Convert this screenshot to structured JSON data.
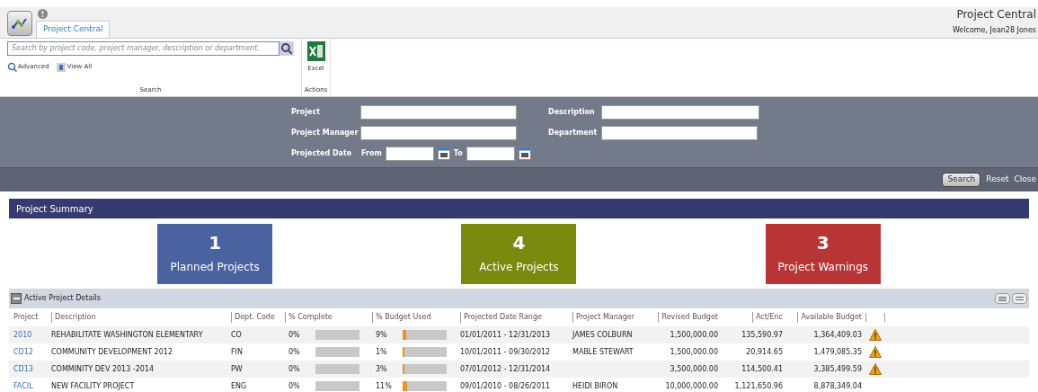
{
  "app": {
    "tab": {
      "label": "Project Central",
      "selected": true
    },
    "title": "Project Central",
    "welcome": "Welcome, Jean28 Jones"
  },
  "ribbon": {
    "search_placeholder": "Search by project code, project manager, description or department.",
    "advanced": "Advanced",
    "view_all": "View All",
    "search_group": "Search",
    "excel": "Excel",
    "actions_group": "Actions"
  },
  "filters": {
    "project": "Project",
    "description": "Description",
    "manager": "Project Manager",
    "department": "Department",
    "date": "Projected Date",
    "from": "From",
    "to": "To",
    "search": "Search",
    "reset": "Reset",
    "close": "Close"
  },
  "summary": {
    "title": "Project Summary",
    "tiles": [
      {
        "count": "1",
        "label": "Planned Projects",
        "color": "#4a62a0"
      },
      {
        "count": "4",
        "label": "Active Projects",
        "color": "#7a8a0e"
      },
      {
        "count": "3",
        "label": "Project Warnings",
        "color": "#b83535"
      }
    ]
  },
  "details": {
    "title": "Active Project Details",
    "expanded": true,
    "columns": [
      "Project",
      "Description",
      "Dept. Code",
      "% Complete",
      "% Budget Used",
      "Projected Date Range",
      "Project Manager",
      "Revised Budget",
      "Act/Enc",
      "Available Budget"
    ],
    "rows": [
      {
        "project": "2010",
        "description": "REHABILITATE WASHINGTON ELEMENTARY",
        "dept": "CO",
        "complete": "0%",
        "budget": "9%",
        "budget_level": {
          "level": 0.09
        },
        "dates": "01/01/2011 - 12/31/2013",
        "manager": "JAMES COLBURN",
        "revised": "1,500,000.00",
        "actenc": "135,590.97",
        "available": "1,364,409.03",
        "warning": true
      },
      {
        "project": "CD12",
        "description": "COMMUNITY DEVELOPMENT 2012",
        "dept": "FIN",
        "complete": "0%",
        "budget": "1%",
        "budget_level": {
          "level": 0.01
        },
        "dates": "10/01/2011 - 09/30/2012",
        "manager": "MABLE STEWART",
        "revised": "1,500,000.00",
        "actenc": "20,914.65",
        "available": "1,479,085.35",
        "warning": true
      },
      {
        "project": "CD13",
        "description": "COMMINITY DEV 2013 -2014",
        "dept": "PW",
        "complete": "0%",
        "budget": "3%",
        "budget_level": {
          "level": 0.03
        },
        "dates": "07/01/2012 - 12/31/2014",
        "revised": "3,500,000.00",
        "actenc": "114,500.41",
        "available": "3,385,499.59",
        "warning": true
      },
      {
        "project": "FACIL",
        "description": "NEW FACILITY PROJECT",
        "dept": "ENG",
        "complete": "0%",
        "budget": "11%",
        "budget_level": {
          "level": 0.11
        },
        "dates": "09/01/2010 - 08/26/2011",
        "manager": "HEIDI BIRON",
        "revised": "10,000,000.00",
        "actenc": "1,121,650.96",
        "available": "8,878,349.04",
        "warning": false
      }
    ]
  }
}
